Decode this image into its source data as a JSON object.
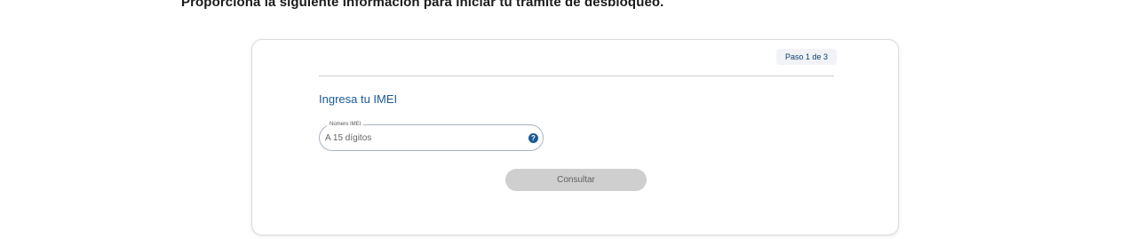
{
  "header": {
    "instruction": "Proporciona la siguiente información para iniciar tu trámite de desbloqueo."
  },
  "card": {
    "step_badge": "Paso 1 de 3",
    "section_title": "Ingresa tu IMEI",
    "imei_field": {
      "label": "Número IMEI",
      "placeholder": "A 15 dígitos",
      "value": "",
      "help_icon": "?"
    },
    "submit_label": "Consultar"
  },
  "colors": {
    "accent": "#1c5a95",
    "button_disabled_bg": "#cfcfcf",
    "badge_bg": "#f1f3f6"
  },
  "icons": {
    "help": "question-mark-circle-icon"
  }
}
